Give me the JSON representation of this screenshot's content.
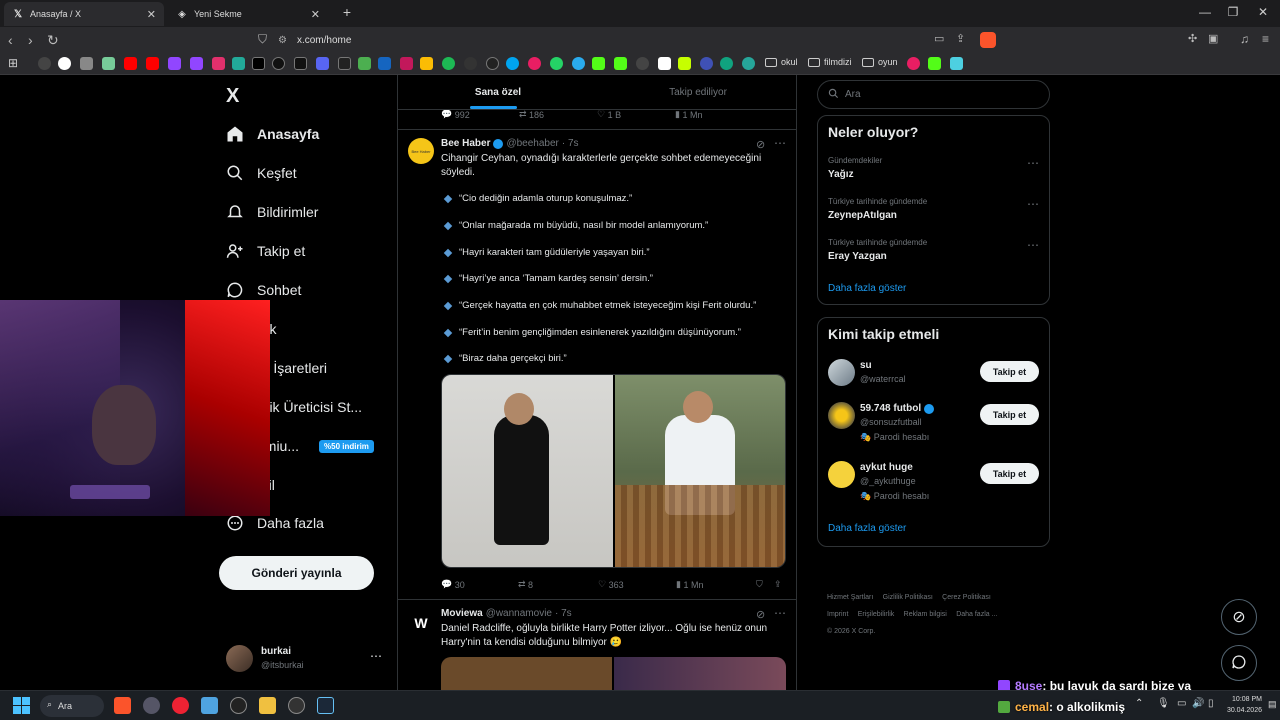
{
  "browser": {
    "tabs": [
      {
        "title": "Anasayfa / X",
        "active": true
      },
      {
        "title": "Yeni Sekme",
        "active": false
      }
    ],
    "new_tab_label": "+",
    "url": "x.com/home",
    "bookmark_folders": [
      "okul",
      "filmdizi",
      "oyun"
    ]
  },
  "nav": {
    "logo": "X",
    "items": [
      {
        "label": "Anasayfa",
        "icon": "home-icon"
      },
      {
        "label": "Keşfet",
        "icon": "search-icon"
      },
      {
        "label": "Bildirimler",
        "icon": "bell-icon"
      },
      {
        "label": "Takip et",
        "icon": "add-user-icon"
      },
      {
        "label": "Sohbet",
        "icon": "chat-icon"
      },
      {
        "label": "rok",
        "icon": "grok-icon"
      },
      {
        "label": "er İşaretleri",
        "icon": "bookmark-icon"
      },
      {
        "label": "erik Üreticisi St...",
        "icon": "creator-icon"
      },
      {
        "label": "emiu...",
        "icon": "premium-icon"
      },
      {
        "label": "ofil",
        "icon": "profile-icon"
      },
      {
        "label": "Daha fazla",
        "icon": "more-icon"
      }
    ],
    "premium_badge": "%50 indirim",
    "post_button": "Gönderi yayınla",
    "account": {
      "name": "burkai",
      "handle": "@itsburkai"
    }
  },
  "feed": {
    "tabs": [
      "Sana özel",
      "Takip ediliyor"
    ],
    "prev_actions": {
      "replies": "992",
      "reposts": "186",
      "likes": "1 B",
      "views": "1 Mn"
    },
    "tweet1": {
      "name": "Bee Haber",
      "handle": "@beehaber",
      "time": "· 7s",
      "avatar_text": "Bee Haber",
      "text": "Cihangir Ceyhan, oynadığı karakterlerle gerçekte sohbet edemeyeceğini söyledi.",
      "bullets": [
        "“Cio dediğin adamla oturup konuşulmaz.”",
        "“Onlar mağarada mı büyüdü, nasıl bir model anlamıyorum.”",
        "“Hayri karakteri tam güdüleriyle yaşayan biri.”",
        "“Hayri’ye anca ‘Tamam kardeş sensin’ dersin.”",
        "“Gerçek hayatta en çok muhabbet etmek isteyeceğim kişi Ferit olurdu.”",
        "“Ferit’in benim gençliğimden esinlenerek yazıldığını düşünüyorum.”",
        "“Biraz daha gerçekçi biri.”"
      ],
      "actions": {
        "replies": "30",
        "reposts": "8",
        "likes": "363",
        "views": "1 Mn"
      }
    },
    "tweet2": {
      "name": "Moviewa",
      "handle": "@wannamovie",
      "time": "· 7s",
      "avatar_text": "W",
      "text": "Daniel Radcliffe, oğluyla birlikte Harry Potter izliyor... Oğlu ise henüz onun Harry'nin ta kendisi olduğunu bilmiyor 🥲"
    }
  },
  "right": {
    "search_placeholder": "Ara",
    "trends_title": "Neler oluyor?",
    "trends": [
      {
        "category": "Gündemdekiler",
        "name": "Yağız"
      },
      {
        "category": "Türkiye tarihinde gündemde",
        "name": "ZeynepAtılgan"
      },
      {
        "category": "Türkiye tarihinde gündemde",
        "name": "Eray Yazgan"
      }
    ],
    "show_more": "Daha fazla göster",
    "follow_title": "Kimi takip etmeli",
    "suggestions": [
      {
        "name": "su",
        "handle": "@waterrcal",
        "parody": ""
      },
      {
        "name": "59.748 futbol",
        "handle": "@sonsuzfutball",
        "parody": "Parodi hesabı"
      },
      {
        "name": "aykut huge",
        "handle": "@_aykuthuge",
        "parody": "Parodi hesabı"
      }
    ],
    "follow_label": "Takip et",
    "footer": [
      "Hizmet Şartları",
      "Gizlilik Politikası",
      "Çerez Politikası",
      "Imprint",
      "Erişilebilirlik",
      "Reklam bilgisi",
      "Daha fazla ...",
      "© 2026 X Corp."
    ]
  },
  "overlay_chat": [
    {
      "user": "8use",
      "text": ": bu lavuk da sardı bize ya"
    },
    {
      "user": "cemal",
      "text": ": o alkolikmiş"
    }
  ],
  "taskbar": {
    "search_label": "Ara",
    "time": "10:08 PM",
    "date": "30.04.2026"
  },
  "colors": {
    "accent": "#1d9bf0",
    "bg": "#000000",
    "border": "#2f3336",
    "muted": "#71767b"
  }
}
